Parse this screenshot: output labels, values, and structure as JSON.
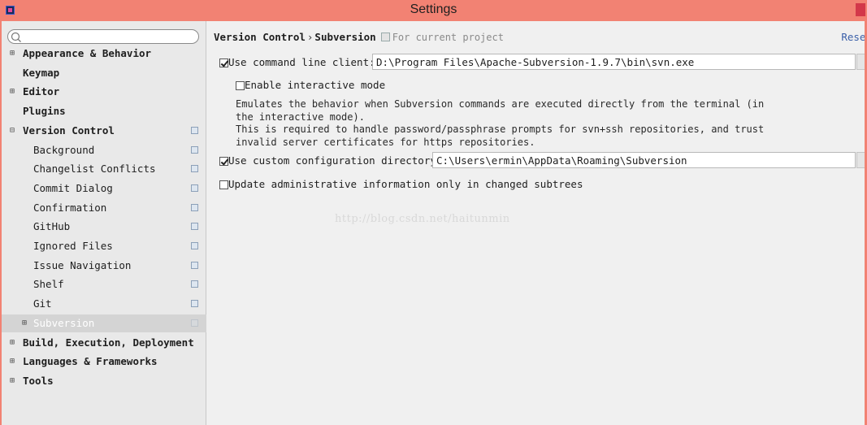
{
  "window": {
    "title": "Settings"
  },
  "search": {
    "placeholder": "",
    "value": ""
  },
  "sidebar": {
    "items": [
      {
        "label": "Appearance & Behavior",
        "expander": "⊞",
        "bold": true
      },
      {
        "label": "Keymap",
        "expander": "",
        "bold": true
      },
      {
        "label": "Editor",
        "expander": "⊞",
        "bold": true
      },
      {
        "label": "Plugins",
        "expander": "",
        "bold": true
      },
      {
        "label": "Version Control",
        "expander": "⊟",
        "bold": true
      },
      {
        "label": "Background"
      },
      {
        "label": "Changelist Conflicts"
      },
      {
        "label": "Commit Dialog"
      },
      {
        "label": "Confirmation"
      },
      {
        "label": "GitHub"
      },
      {
        "label": "Ignored Files"
      },
      {
        "label": "Issue Navigation"
      },
      {
        "label": "Shelf"
      },
      {
        "label": "Git"
      },
      {
        "label": "Subversion",
        "expander": "⊞",
        "selected": true
      },
      {
        "label": "Build, Execution, Deployment",
        "expander": "⊞",
        "bold": true
      },
      {
        "label": "Languages & Frameworks",
        "expander": "⊞",
        "bold": true
      },
      {
        "label": "Tools",
        "expander": "⊞",
        "bold": true
      }
    ]
  },
  "breadcrumb": {
    "parent": "Version Control",
    "separator": "›",
    "current": "Subversion",
    "scope": "For current project",
    "reset_label": "Reset"
  },
  "options": {
    "use_cmd_client": {
      "label": "Use command line client:",
      "checked": true,
      "value": "D:\\Program Files\\Apache-Subversion-1.9.7\\bin\\svn.exe"
    },
    "interactive_mode": {
      "label": "Enable interactive mode",
      "checked": false
    },
    "description": "Emulates the behavior when Subversion commands are executed directly from the terminal (in\nthe interactive mode).\nThis is required to handle password/passphrase prompts for svn+ssh repositories, and trust\ninvalid server certificates for https repositories.",
    "custom_config": {
      "label": "Use custom configuration directory:",
      "checked": true,
      "value": "C:\\Users\\ermin\\AppData\\Roaming\\Subversion"
    },
    "update_admin": {
      "label": "Update administrative information only in changed subtrees",
      "checked": false
    }
  },
  "watermark": "http://blog.csdn.net/haitunmin",
  "colors": {
    "titlebar": "#f28273",
    "sidebar": "#e9e9e9",
    "selection": "#d4d4d4",
    "link": "#3a5fa8"
  },
  "icons": {
    "search": "search-icon",
    "project": "project-scope-icon"
  }
}
